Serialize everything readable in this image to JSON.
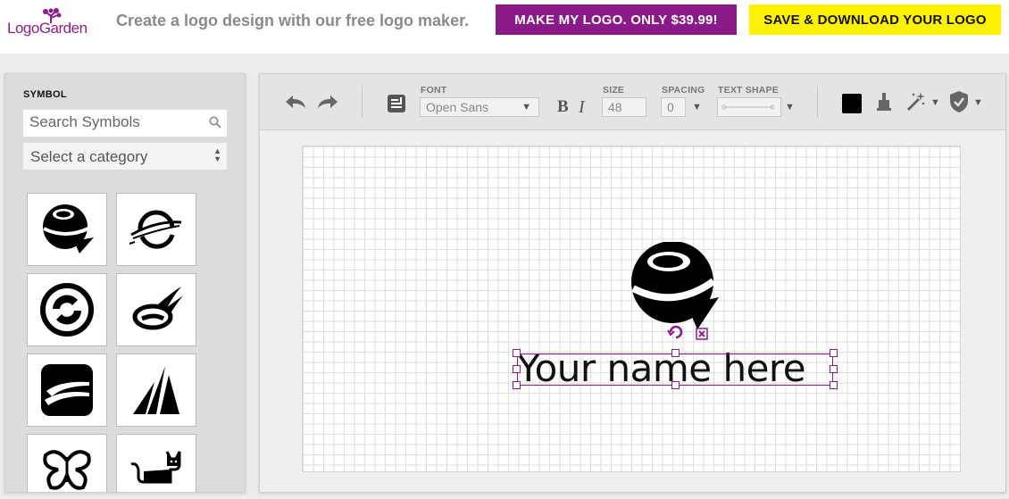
{
  "header": {
    "logo_text": "LogoGarden",
    "tagline": "Create a logo design with our free logo maker.",
    "make_logo_label": "MAKE MY LOGO. ONLY $39.99!",
    "save_download_label": "SAVE & DOWNLOAD YOUR LOGO",
    "colors": {
      "brand": "#8a1a88",
      "save": "#fff200"
    }
  },
  "sidebar": {
    "title": "SYMBOL",
    "search_placeholder": "Search Symbols",
    "category_select": "Select a category",
    "symbols": [
      "globe-arrow",
      "ringed-sphere",
      "circular-swirl",
      "orbit-swoosh",
      "rounded-square-stripes",
      "sail-pyramid",
      "butterfly",
      "cat"
    ]
  },
  "toolbar": {
    "font_label": "FONT",
    "font_value": "Open Sans",
    "bold_label": "B",
    "italic_label": "I",
    "size_label": "SIZE",
    "size_value": "48",
    "spacing_label": "SPACING",
    "spacing_value": "0",
    "text_shape_label": "TEXT SHAPE",
    "color_swatch": "#000000"
  },
  "canvas": {
    "text": "Your name here"
  }
}
